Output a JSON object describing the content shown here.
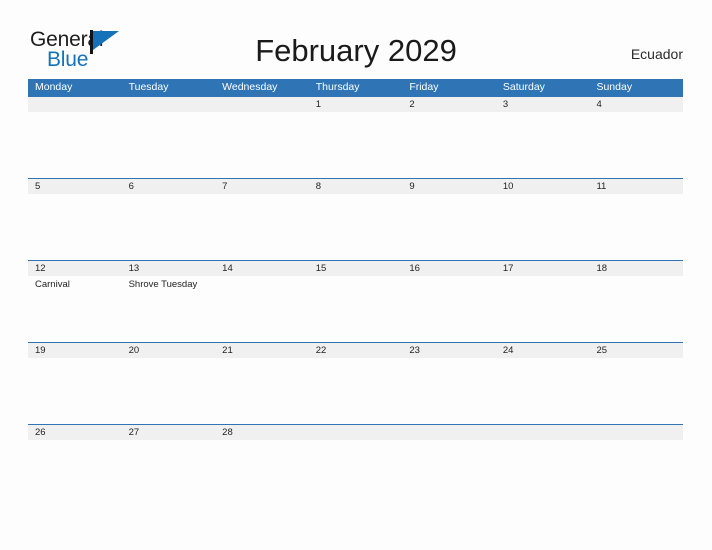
{
  "brand": {
    "name_part1": "General",
    "name_part2": "Blue",
    "primary_color": "#1672b8",
    "flag_icon": "flag-triangle-icon"
  },
  "header": {
    "title": "February 2029",
    "country": "Ecuador"
  },
  "calendar": {
    "month": "February",
    "year": "2029",
    "header_color": "#2f74b5",
    "date_band_color": "#f0f0f0",
    "weekdays": [
      "Monday",
      "Tuesday",
      "Wednesday",
      "Thursday",
      "Friday",
      "Saturday",
      "Sunday"
    ],
    "weeks": [
      {
        "days": [
          {
            "date": "",
            "event": ""
          },
          {
            "date": "",
            "event": ""
          },
          {
            "date": "",
            "event": ""
          },
          {
            "date": "1",
            "event": ""
          },
          {
            "date": "2",
            "event": ""
          },
          {
            "date": "3",
            "event": ""
          },
          {
            "date": "4",
            "event": ""
          }
        ]
      },
      {
        "days": [
          {
            "date": "5",
            "event": ""
          },
          {
            "date": "6",
            "event": ""
          },
          {
            "date": "7",
            "event": ""
          },
          {
            "date": "8",
            "event": ""
          },
          {
            "date": "9",
            "event": ""
          },
          {
            "date": "10",
            "event": ""
          },
          {
            "date": "11",
            "event": ""
          }
        ]
      },
      {
        "days": [
          {
            "date": "12",
            "event": "Carnival"
          },
          {
            "date": "13",
            "event": "Shrove Tuesday"
          },
          {
            "date": "14",
            "event": ""
          },
          {
            "date": "15",
            "event": ""
          },
          {
            "date": "16",
            "event": ""
          },
          {
            "date": "17",
            "event": ""
          },
          {
            "date": "18",
            "event": ""
          }
        ]
      },
      {
        "days": [
          {
            "date": "19",
            "event": ""
          },
          {
            "date": "20",
            "event": ""
          },
          {
            "date": "21",
            "event": ""
          },
          {
            "date": "22",
            "event": ""
          },
          {
            "date": "23",
            "event": ""
          },
          {
            "date": "24",
            "event": ""
          },
          {
            "date": "25",
            "event": ""
          }
        ]
      },
      {
        "days": [
          {
            "date": "26",
            "event": ""
          },
          {
            "date": "27",
            "event": ""
          },
          {
            "date": "28",
            "event": ""
          },
          {
            "date": "",
            "event": ""
          },
          {
            "date": "",
            "event": ""
          },
          {
            "date": "",
            "event": ""
          },
          {
            "date": "",
            "event": ""
          }
        ]
      }
    ]
  }
}
